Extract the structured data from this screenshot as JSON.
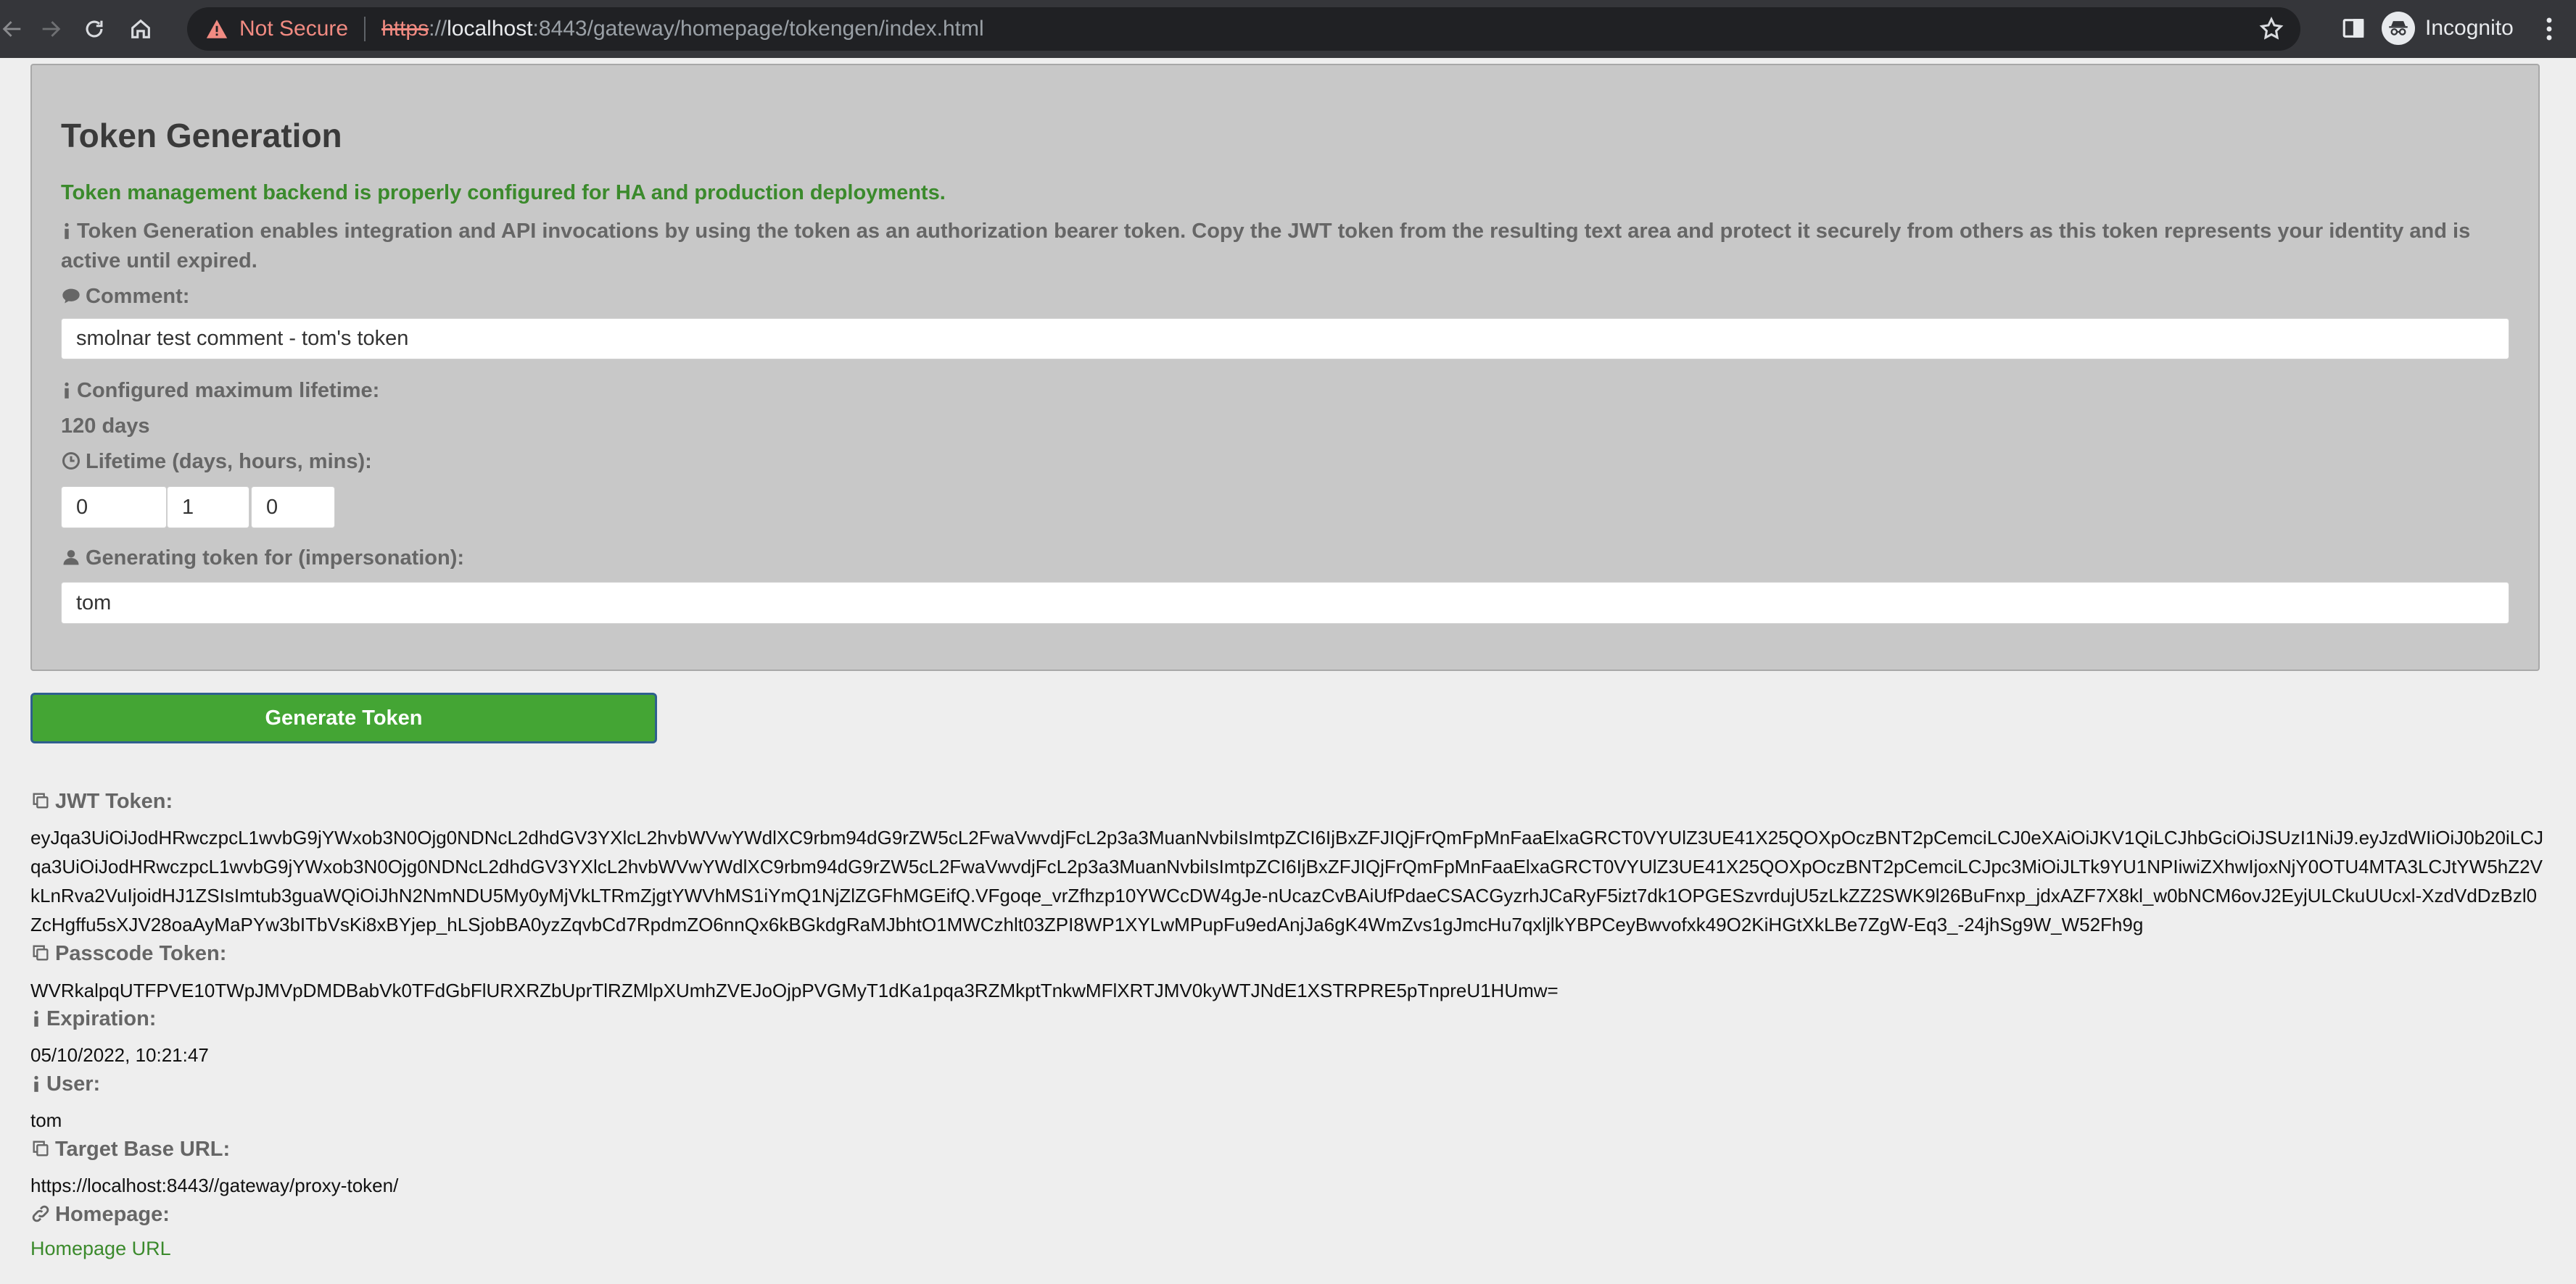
{
  "browser": {
    "not_secure": "Not Secure",
    "url_scheme": "https",
    "url_scheme_sep": "://",
    "url_host": "localhost",
    "url_path": ":8443/gateway/homepage/tokengen/index.html",
    "profile": "Incognito"
  },
  "form": {
    "title": "Token Generation",
    "status_message": "Token management backend is properly configured for HA and production deployments.",
    "info": "Token Generation enables integration and API invocations by using the token as an authorization bearer token. Copy the JWT token from the resulting text area and protect it securely from others as this token represents your identity and is active until expired.",
    "comment_label": "Comment:",
    "comment_value": "smolnar test comment - tom's token",
    "max_lifetime_label": "Configured maximum lifetime:",
    "max_lifetime_value": "120 days",
    "lifetime_label": "Lifetime (days, hours, mins):",
    "lifetime_days": "0",
    "lifetime_hours": "1",
    "lifetime_mins": "0",
    "impersonation_label": "Generating token for (impersonation):",
    "impersonation_value": "tom",
    "generate_button": "Generate Token"
  },
  "result": {
    "jwt_label": "JWT Token:",
    "jwt_value": "eyJqa3UiOiJodHRwczpcL1wvbG9jYWxob3N0Ojg0NDNcL2dhdGV3YXlcL2hvbWVwYWdlXC9rbm94dG9rZW5cL2FwaVwvdjFcL2p3a3MuanNvbiIsImtpZCI6IjBxZFJIQjFrQmFpMnFaaElxaGRCT0VYUlZ3UE41X25QOXpOczBNT2pCemciLCJ0eXAiOiJKV1QiLCJhbGciOiJSUzI1NiJ9.eyJzdWIiOiJ0b20iLCJqa3UiOiJodHRwczpcL1wvbG9jYWxob3N0Ojg0NDNcL2dhdGV3YXlcL2hvbWVwYWdlXC9rbm94dG9rZW5cL2FwaVwvdjFcL2p3a3MuanNvbiIsImtpZCI6IjBxZFJIQjFrQmFpMnFaaElxaGRCT0VYUlZ3UE41X25QOXpOczBNT2pCemciLCJpc3MiOiJLTk9YU1NPIiwiZXhwIjoxNjY0OTU4MTA3LCJtYW5hZ2VkLnRva2VuIjoidHJ1ZSIsImtub3guaWQiOiJhN2NmNDU5My0yMjVkLTRmZjgtYWVhMS1iYmQ1NjZlZGFhMGEifQ.VFgoqe_vrZfhzp10YWCcDW4gJe-nUcazCvBAiUfPdaeCSACGyzrhJCaRyF5izt7dk1OPGESzvrdujU5zLkZZ2SWK9l26BuFnxp_jdxAZF7X8kl_w0bNCM6ovJ2EyjULCkuUUcxl-XzdVdDzBzl0ZcHgffu5sXJV28oaAyMaPYw3bITbVsKi8xBYjep_hLSjobBA0yzZqvbCd7RpdmZO6nnQx6kBGkdgRaMJbhtO1MWCzhlt03ZPI8WP1XYLwMPupFu9edAnjJa6gK4WmZvs1gJmcHu7qxljlkYBPCeyBwvofxk49O2KiHGtXkLBe7ZgW-Eq3_-24jhSg9W_W52Fh9g",
    "passcode_label": "Passcode Token:",
    "passcode_value": "WVRkalpqUTFPVE10TWpJMVpDMDBabVk0TFdGbFlURXRZbUprTlRZMlpXUmhZVEJoOjpPVGMyT1dKa1pqa3RZMkptTnkwMFlXRTJMV0kyWTJNdE1XSTRPRE5pTnpreU1HUmw=",
    "expiration_label": "Expiration:",
    "expiration_value": "05/10/2022, 10:21:47",
    "user_label": "User:",
    "user_value": "tom",
    "target_url_label": "Target Base URL:",
    "target_url_value": "https://localhost:8443//gateway/proxy-token/",
    "homepage_label": "Homepage:",
    "homepage_link": "Homepage URL"
  },
  "icons": {
    "back": "arrow-left-icon",
    "forward": "arrow-right-icon",
    "reload": "reload-icon",
    "home": "home-icon",
    "warning": "warning-icon",
    "bookmark": "star-icon",
    "sidepanel": "side-panel-icon",
    "incognito": "incognito-icon",
    "menu": "kebab-menu-icon",
    "info": "info-icon",
    "comment": "comment-icon",
    "clock": "clock-icon",
    "user": "user-icon",
    "copy": "copy-icon",
    "link": "link-icon"
  },
  "colors": {
    "accent_green": "#44a534",
    "status_green": "#3b8a2c",
    "panel_bg": "#c8c8c8",
    "page_bg": "#eeeeee",
    "chrome_bg": "#35363a"
  }
}
